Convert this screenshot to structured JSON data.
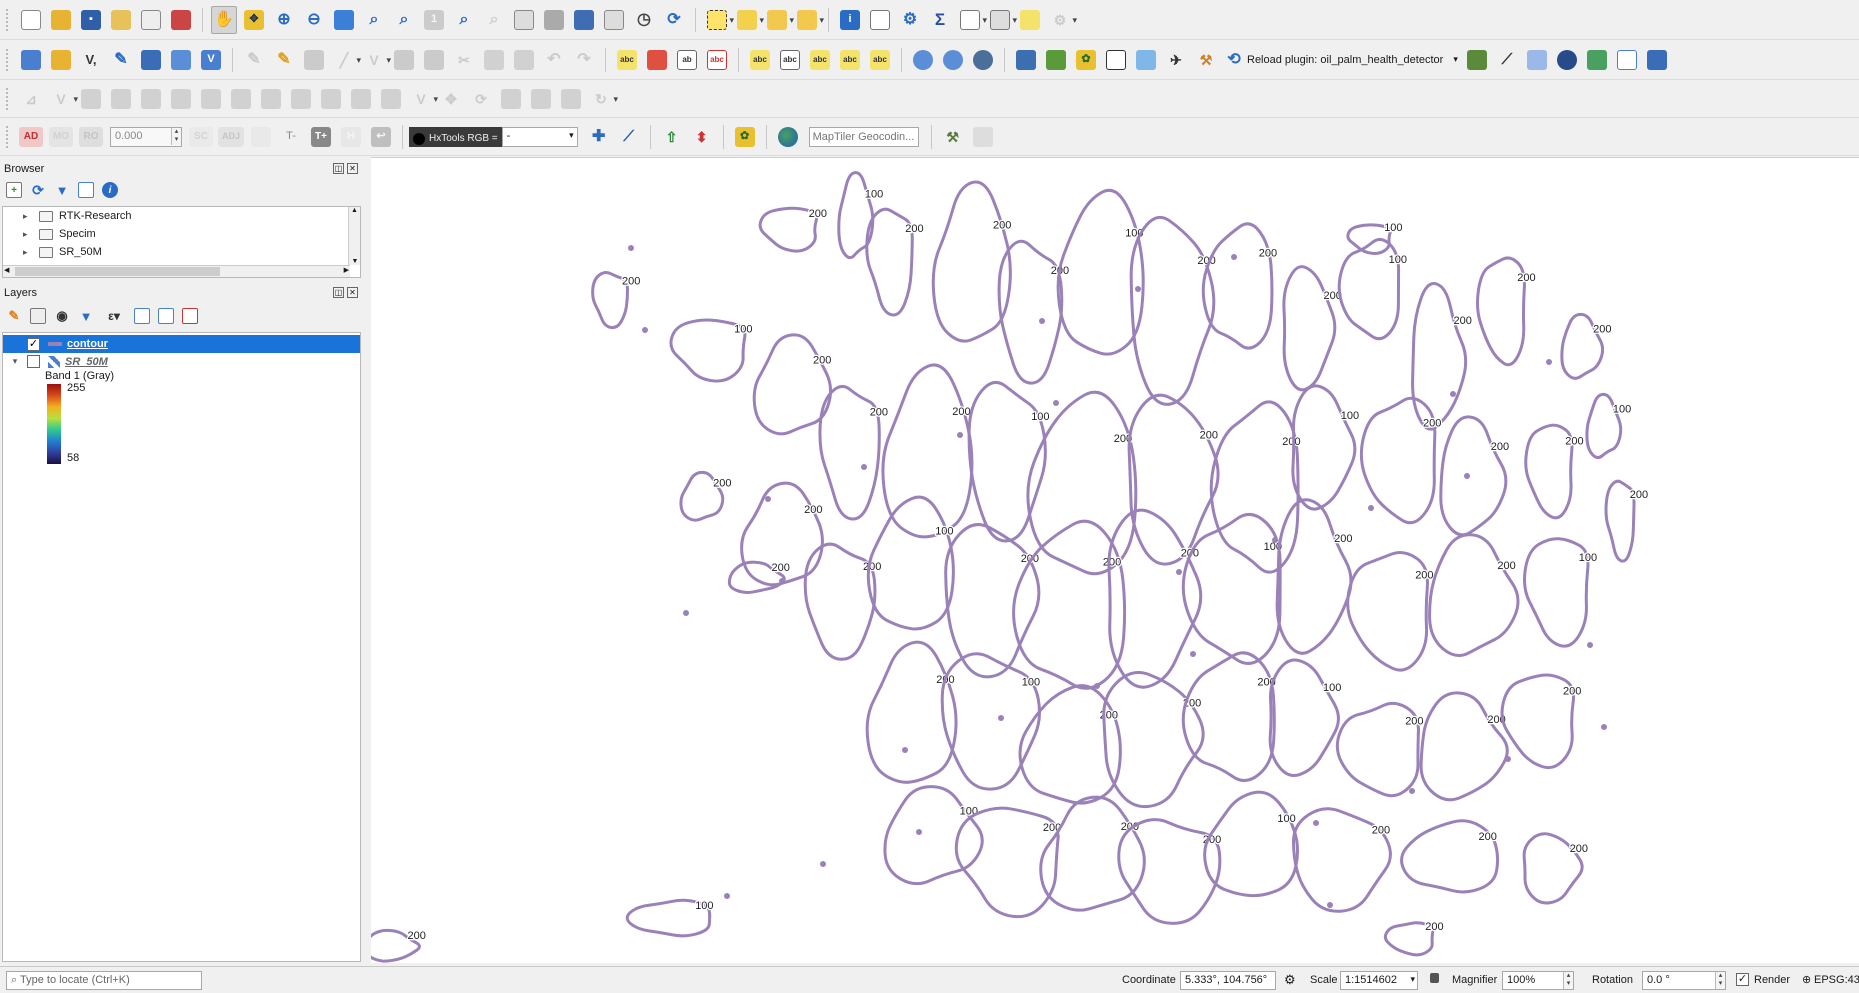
{
  "toolbar4": {
    "ad": "AD",
    "mo": "MO",
    "ro": "RO",
    "value": "0.000",
    "sc": "SC",
    "adj": "ADJ",
    "t_minus": "T-",
    "t_plus": "T+",
    "hxtools_label": "HxTools RGB =",
    "hxtools_value": "-",
    "geocoding_placeholder": "MapTiler Geocodin..."
  },
  "toolbar2": {
    "reload_label": "Reload plugin: oil_palm_health_detector"
  },
  "browser": {
    "title": "Browser",
    "items": [
      {
        "label": "RTK-Research"
      },
      {
        "label": "Specim"
      },
      {
        "label": "SR_50M"
      }
    ]
  },
  "layers": {
    "title": "Layers",
    "items": [
      {
        "label": "contour",
        "checked": true
      },
      {
        "label": "SR_50M",
        "checked": false
      }
    ],
    "band_label": "Band 1 (Gray)",
    "legend_max": "255",
    "legend_min": "58"
  },
  "map": {
    "contour_color": "#9a82b8",
    "labels": [
      "200",
      "100"
    ]
  },
  "statusbar": {
    "locate_placeholder": "Type to locate (Ctrl+K)",
    "coordinate_label": "Coordinate",
    "coordinate_value": "5.333°, 104.756°",
    "scale_label": "Scale",
    "scale_value": "1:1514602",
    "magnifier_label": "Magnifier",
    "magnifier_value": "100%",
    "rotation_label": "Rotation",
    "rotation_value": "0.0 °",
    "render_label": "Render",
    "crs_label": "EPSG:43"
  },
  "colors": {
    "selection": "#1a73d9",
    "contour": "#9a82b8"
  }
}
